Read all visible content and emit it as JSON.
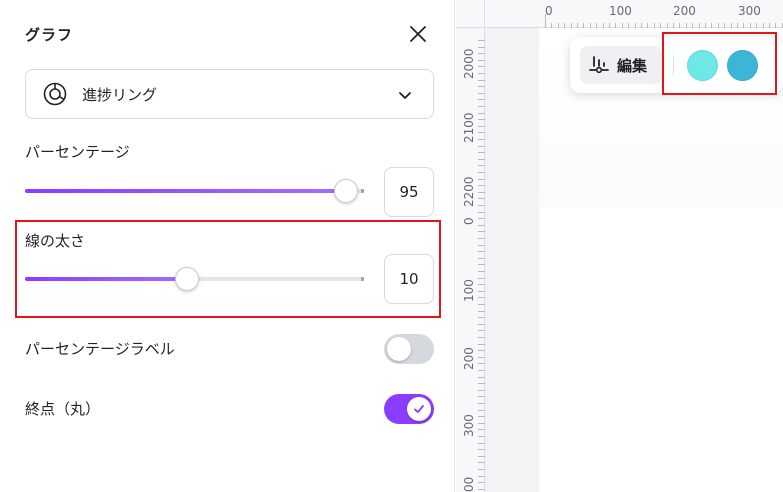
{
  "panel": {
    "title": "グラフ",
    "chart_type": {
      "selected": "進捗リング"
    }
  },
  "percentage": {
    "label": "パーセンテージ",
    "value": "95",
    "level": 0.95
  },
  "line_width": {
    "label": "線の太さ",
    "value": "10",
    "level": 0.48
  },
  "percentage_label": {
    "label": "パーセンテージラベル",
    "enabled": false
  },
  "end_cap": {
    "label": "終点（丸）",
    "enabled": true
  },
  "canvas": {
    "edit_label": "編集",
    "swatches": [
      "#6ee7e6",
      "#3cb6d6"
    ],
    "ruler_top": [
      "0",
      "100",
      "200",
      "300"
    ],
    "ruler_left": [
      "2000",
      "2100",
      "2200",
      "0",
      "100",
      "200",
      "300",
      "00"
    ]
  },
  "colors": {
    "accent": "#8b3dff",
    "highlight": "#e0161b"
  }
}
